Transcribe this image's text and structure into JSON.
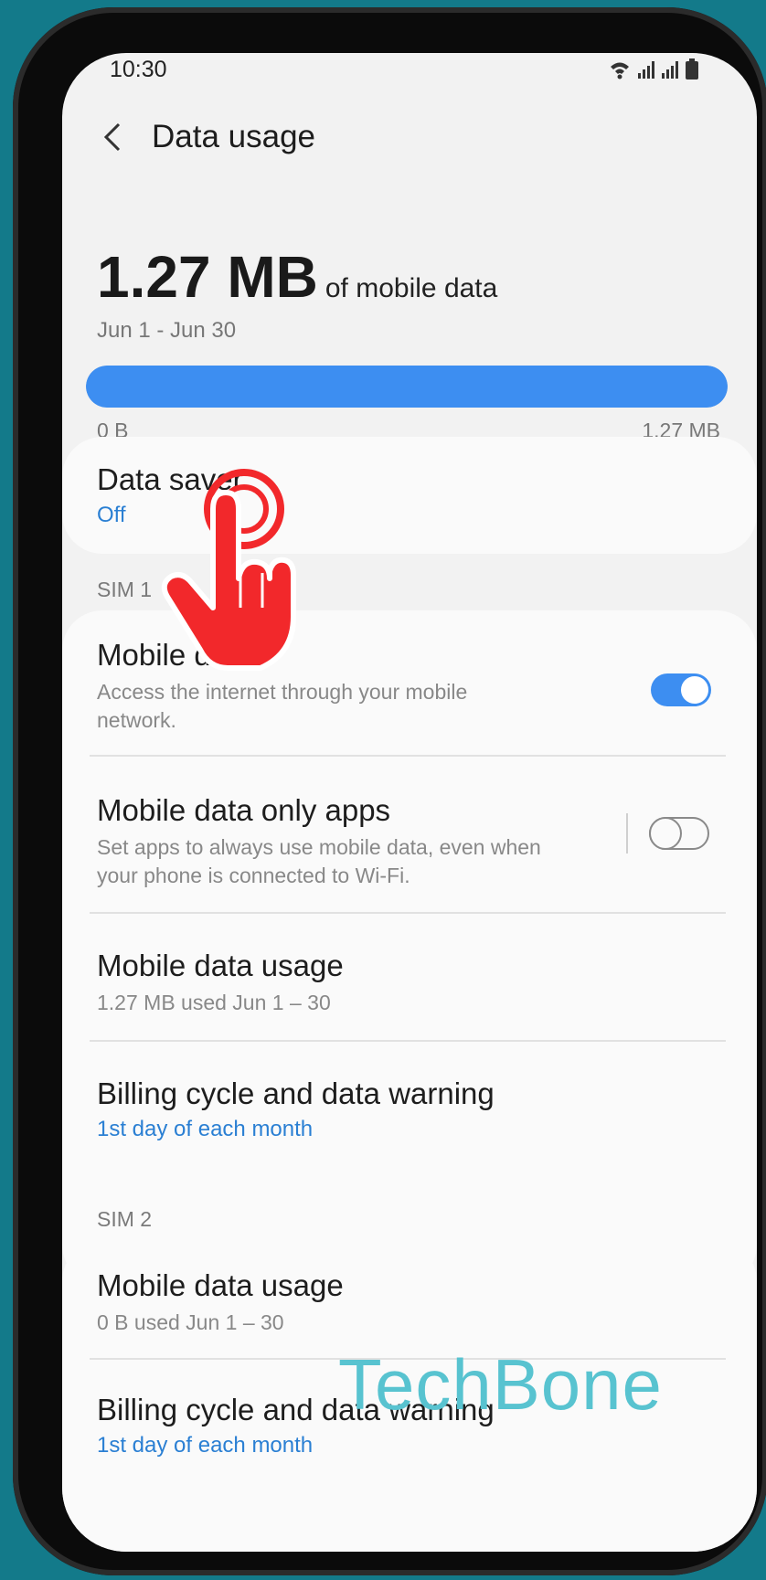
{
  "status_bar": {
    "time": "10:30",
    "icons": [
      "wifi-icon",
      "signal-icon",
      "signal-icon",
      "battery-icon"
    ]
  },
  "header": {
    "title": "Data usage",
    "back_icon": "chevron-left-icon"
  },
  "summary": {
    "value": "1.27 MB",
    "suffix": "of mobile data",
    "period": "Jun 1 - Jun 30",
    "bar_fill_fraction": 1.0,
    "scale_min": "0 B",
    "scale_max": "1.27 MB"
  },
  "data_saver": {
    "title": "Data saver",
    "status": "Off"
  },
  "sim1": {
    "label": "SIM 1",
    "mobile_data": {
      "title": "Mobile data",
      "description": "Access the internet through your mobile network.",
      "toggle_on": true
    },
    "mobile_data_only_apps": {
      "title": "Mobile data only apps",
      "description": "Set apps to always use mobile data, even when your phone is connected to Wi-Fi.",
      "toggle_on": false
    },
    "mobile_data_usage": {
      "title": "Mobile data usage",
      "detail": "1.27 MB used Jun 1 – 30"
    },
    "billing_cycle": {
      "title": "Billing cycle and data warning",
      "detail": "1st day of each month"
    }
  },
  "sim2": {
    "label": "SIM 2",
    "mobile_data_usage": {
      "title": "Mobile data usage",
      "detail": "0 B used Jun 1 – 30"
    },
    "billing_cycle": {
      "title": "Billing cycle and data warning",
      "detail": "1st day of each month"
    }
  },
  "overlay": {
    "tap_icon": "tap-hand-icon",
    "watermark": "TechBone"
  },
  "colors": {
    "accent": "#3d8ef1",
    "link": "#2a7fd3",
    "tap": "#f2282b",
    "watermark": "#58c3d0",
    "background": "#137a8a"
  }
}
